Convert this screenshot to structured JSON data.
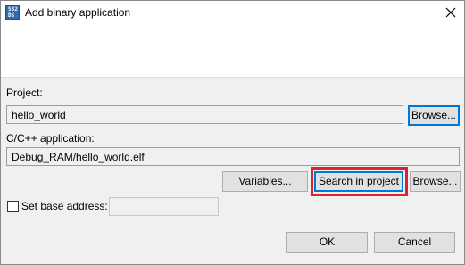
{
  "window": {
    "title": "Add binary application",
    "icon": "s32ds-app-icon",
    "icon_text": [
      "S32",
      "DS"
    ]
  },
  "project": {
    "label": "Project:",
    "value": "hello_world",
    "browse_label": "Browse..."
  },
  "application": {
    "label": "C/C++ application:",
    "value": "Debug_RAM/hello_world.elf",
    "variables_label": "Variables...",
    "search_label": "Search in project",
    "browse_label": "Browse..."
  },
  "base_address": {
    "label": "Set base address:",
    "checked": false,
    "value": ""
  },
  "footer": {
    "ok_label": "OK",
    "cancel_label": "Cancel"
  },
  "colors": {
    "highlight": "#d9262b",
    "focus": "#0078d7"
  }
}
